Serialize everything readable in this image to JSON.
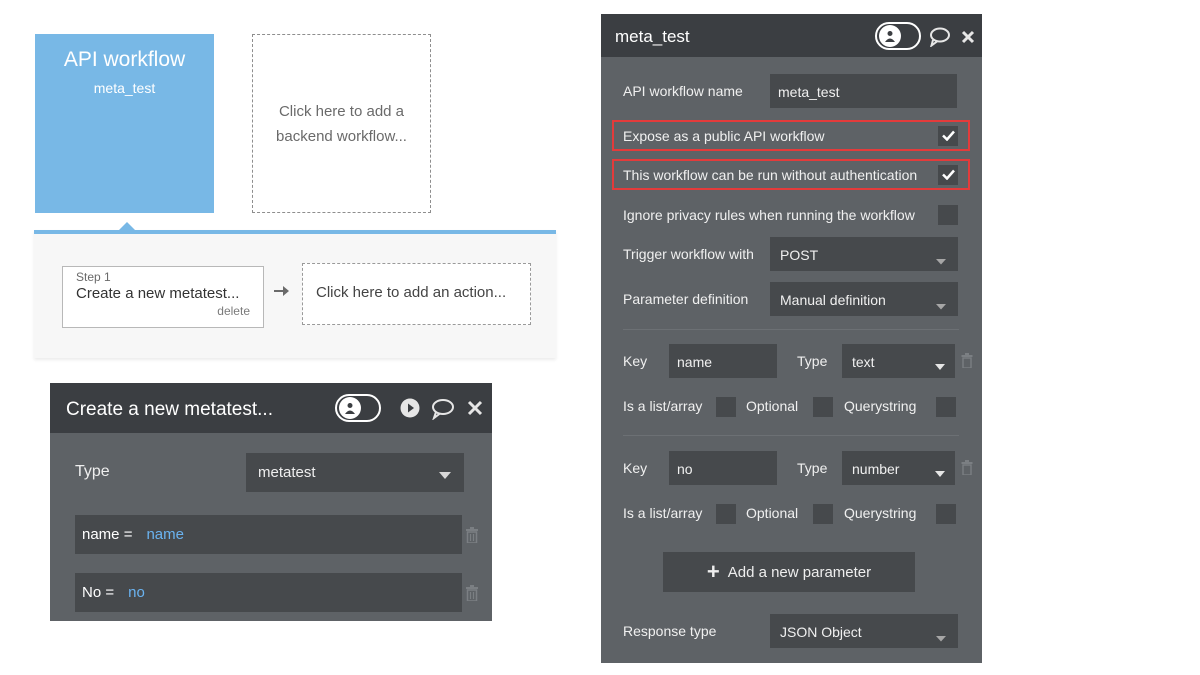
{
  "canvas": {
    "api_card_title": "API workflow",
    "api_card_name": "meta_test",
    "add_backend_line1": "Click here to add a",
    "add_backend_line2": "backend workflow...",
    "step_num": "Step 1",
    "step_title": "Create a new metatest...",
    "step_delete": "delete",
    "add_action": "Click here to add an action..."
  },
  "action_editor": {
    "title": "Create a new metatest...",
    "type_label": "Type",
    "type_value": "metatest",
    "fields": [
      {
        "name": "name =",
        "value": "name"
      },
      {
        "name": "No =",
        "value": "no"
      }
    ]
  },
  "workflow_panel": {
    "title": "meta_test",
    "name_label": "API workflow name",
    "name_value": "meta_test",
    "expose_label": "Expose as a public API workflow",
    "expose_checked": true,
    "noauth_label": "This workflow can be run without authentication",
    "noauth_checked": true,
    "privacy_label": "Ignore privacy rules when running the workflow",
    "privacy_checked": false,
    "trigger_label": "Trigger workflow with",
    "trigger_value": "POST",
    "paramdef_label": "Parameter definition",
    "paramdef_value": "Manual definition",
    "params": [
      {
        "key_label": "Key",
        "key": "name",
        "type_label": "Type",
        "type": "text",
        "list_label": "Is a list/array",
        "optional_label": "Optional",
        "query_label": "Querystring"
      },
      {
        "key_label": "Key",
        "key": "no",
        "type_label": "Type",
        "type": "number",
        "list_label": "Is a list/array",
        "optional_label": "Optional",
        "query_label": "Querystring"
      }
    ],
    "add_param": "Add a new parameter",
    "response_label": "Response type",
    "response_value": "JSON Object"
  },
  "colors": {
    "accent_blue": "#78b8e6",
    "panel_dark": "#3b3e42",
    "panel_body": "#5e6266",
    "highlight_red": "#e43b3b",
    "link_blue": "#6ab3f0"
  }
}
